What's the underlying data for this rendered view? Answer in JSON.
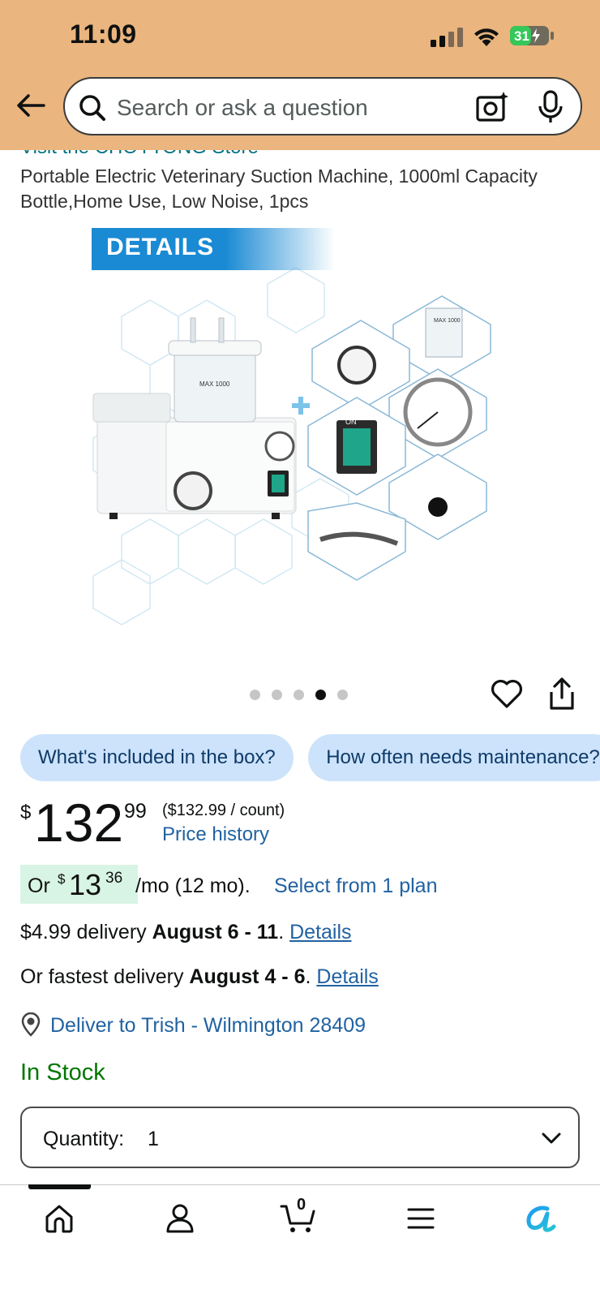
{
  "status_bar": {
    "time": "11:09",
    "battery": "31"
  },
  "search": {
    "placeholder": "Search or ask a question"
  },
  "product": {
    "store_link": "Visit the CHOYTONG Store",
    "title": "Portable Electric Veterinary Suction Machine, 1000ml Capacity Bottle,Home Use, Low Noise, 1pcs",
    "image_banner": "DETAILS",
    "image_count": 5,
    "active_image_index": 4
  },
  "chips": [
    "What's included in the box?",
    "How often needs maintenance?"
  ],
  "price": {
    "symbol": "$",
    "whole": "132",
    "fraction": "99",
    "unit_price": "($132.99 / count)",
    "history_link": "Price history"
  },
  "installment": {
    "or": "Or",
    "symbol": "$",
    "whole": "13",
    "fraction": "36",
    "terms": "/mo (12 mo).",
    "link": "Select from 1 plan"
  },
  "delivery": {
    "standard_prefix": "$4.99 delivery",
    "standard_date": "August 6 - 11",
    "fastest_prefix": "Or fastest delivery",
    "fastest_date": "August 4 - 6",
    "details_link": "Details",
    "location": "Deliver to Trish - Wilmington 28409"
  },
  "stock_status": "In Stock",
  "quantity": {
    "label": "Quantity:",
    "value": "1"
  },
  "bottom_nav": {
    "cart_count": "0",
    "items": [
      "home-icon",
      "account-icon",
      "cart-icon",
      "menu-icon",
      "rufus-icon"
    ]
  },
  "colors": {
    "header_bg": "#eab57e",
    "link": "#2162a1",
    "in_stock": "#007600",
    "chip_bg": "#cce3fb",
    "installment_badge": "#d8f4e4"
  }
}
